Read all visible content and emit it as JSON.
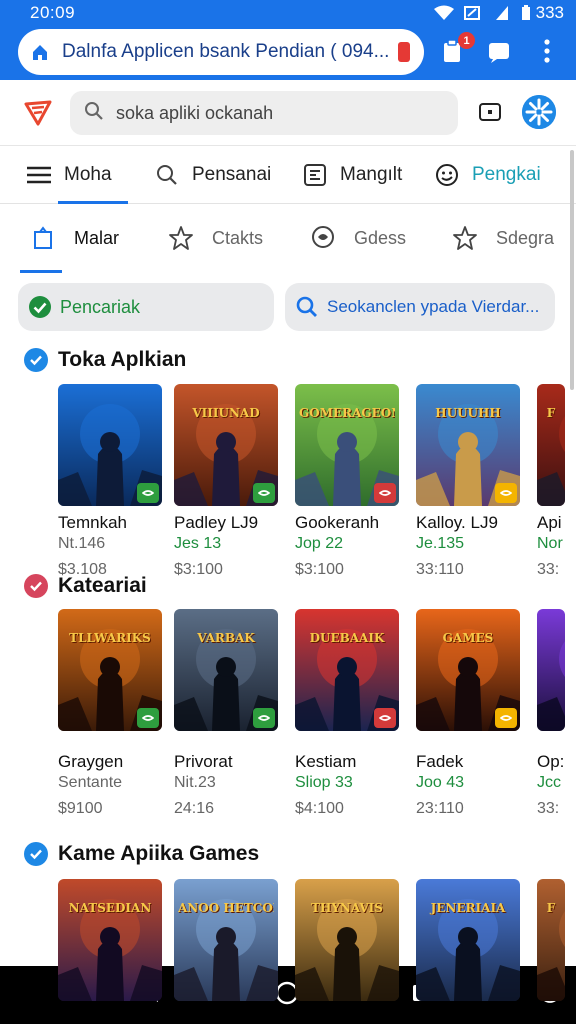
{
  "status": {
    "time": "20:09",
    "battery": "333"
  },
  "browser": {
    "url": "Dalnfa Applicen bsank Pendian ( 094...",
    "notif_count": "1"
  },
  "search": {
    "placeholder": "soka apliki ockanah"
  },
  "nav": {
    "items": [
      {
        "label": "Moha",
        "icon": "hamburger-icon"
      },
      {
        "label": "Pensanai",
        "icon": "search-icon"
      },
      {
        "label": "Mangılt",
        "icon": "grid-icon"
      },
      {
        "label": "Pengkai",
        "icon": "smiley-icon"
      }
    ]
  },
  "tabs": {
    "items": [
      {
        "label": "Malar",
        "icon": "home-icon"
      },
      {
        "label": "Ctakts",
        "icon": "star-icon"
      },
      {
        "label": "Gdess",
        "icon": "chat-icon"
      },
      {
        "label": "Sdegra",
        "icon": "star-icon"
      }
    ]
  },
  "chips": {
    "left": "Pencariak",
    "right": "Seokanclen ypada Vierdar..."
  },
  "sections": [
    {
      "title": "Toka Aplkian",
      "icon_color": "#1e88e5",
      "cards": [
        {
          "title": "Temnkah",
          "sub": "Nt.146",
          "price": "$3.108",
          "sub_color": "gray"
        },
        {
          "title": "Padley LJ9",
          "sub": "Jes 13",
          "price": "$3:100",
          "sub_color": "green"
        },
        {
          "title": "Gookeranh",
          "sub": "Jop 22",
          "price": "$3:100",
          "sub_color": "green"
        },
        {
          "title": "Kalloy. LJ9",
          "sub": "Je.135",
          "price": "33:110",
          "sub_color": "green"
        },
        {
          "title": "Api",
          "sub": "Nor",
          "price": "33:",
          "sub_color": "green"
        }
      ]
    },
    {
      "title": "Kateariai",
      "icon_color": "#d6455d",
      "cards": [
        {
          "title": "Graygen",
          "sub": "Sentante",
          "price": "$9100",
          "sub_color": "gray"
        },
        {
          "title": "Privorat",
          "sub": "Nit.23",
          "price": "24:16",
          "sub_color": "gray"
        },
        {
          "title": "Kestiam",
          "sub": "Sliop 33",
          "price": "$4:100",
          "sub_color": "green"
        },
        {
          "title": "Fadek",
          "sub": "Joo 43",
          "price": "23:110",
          "sub_color": "green"
        },
        {
          "title": "Op:",
          "sub": "Jcc",
          "price": "33:",
          "sub_color": "green"
        }
      ]
    },
    {
      "title": "Kame Apiika Games",
      "icon_color": "#1e88e5",
      "cards": []
    }
  ],
  "thumb_texts": {
    "r1": [
      "",
      "VIIIUNAD",
      "GOMERAGEON",
      "HUUUHH",
      "F"
    ],
    "r2": [
      "TLLWARIKS",
      "VARBAK",
      "DUEBAAIK",
      "GAMES",
      ""
    ],
    "r3": [
      "NATSEDIAN",
      "ANOO HETCOMITS",
      "THYNAVIS",
      "JENERIAIA",
      "F"
    ]
  },
  "colors": {
    "accent": "#1a73e8",
    "green": "#1e8e3e",
    "badge": "#e53935"
  }
}
